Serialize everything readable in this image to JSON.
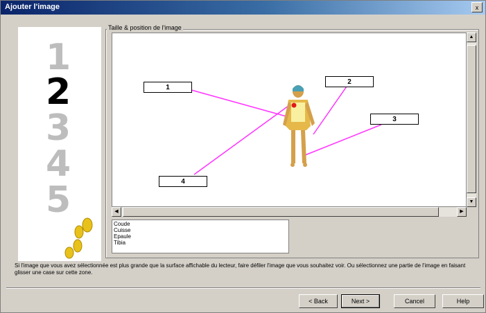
{
  "window": {
    "title": "Ajouter l'image",
    "close_label": "x"
  },
  "steps": [
    "1",
    "2",
    "3",
    "4",
    "5"
  ],
  "active_step": 2,
  "group_label": "Taille & position de l'image",
  "markers": [
    "1",
    "2",
    "3",
    "4"
  ],
  "list_items": [
    "Coude",
    "Cuisse",
    "Epaule",
    "Tibia"
  ],
  "help_text": "Si l'image que vous avez sélectionnée est plus grande que la surface affichable du lecteur, faire défiler l'image que vous souhaitez voir. Ou sélectionnez une partie de l'image en faisant glisser une case sur cette zone.",
  "buttons": {
    "back": "< Back",
    "next": "Next >",
    "cancel": "Cancel",
    "help": "Help"
  },
  "colors": {
    "leader_lines": "#ff33ff",
    "titlebar": "#0a246a",
    "active_step": "#000000",
    "inactive_step": "#bdbdbd"
  },
  "icons": {
    "footprints": "footprints-icon"
  }
}
